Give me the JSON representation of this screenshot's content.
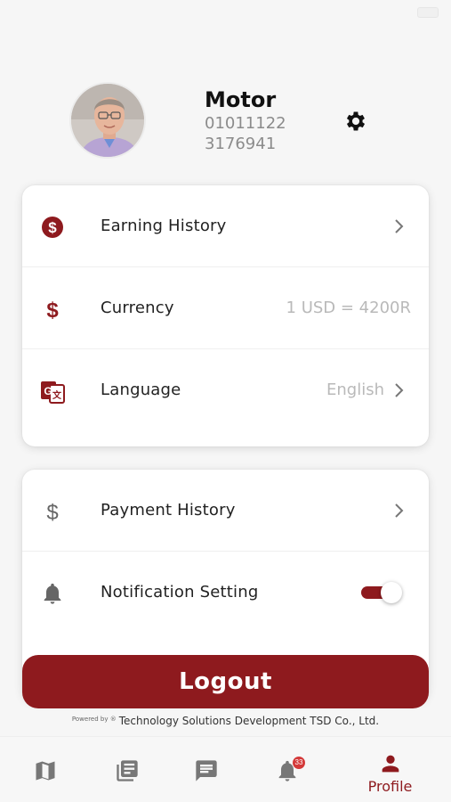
{
  "profile": {
    "name": "Motor",
    "id_line1": "01011122",
    "id_line2": "3176941"
  },
  "menu_primary": [
    {
      "label": "Earning History",
      "icon": "dollar-circle-icon"
    },
    {
      "label": "Currency",
      "value": "1 USD = 4200R",
      "icon": "dollar-icon"
    },
    {
      "label": "Language",
      "value": "English",
      "icon": "translate-icon"
    }
  ],
  "menu_secondary": [
    {
      "label": "Payment History",
      "icon": "dollar-icon"
    },
    {
      "label": "Notification Setting",
      "icon": "bell-icon",
      "toggle_on": true
    }
  ],
  "logout_label": "Logout",
  "footer": {
    "powered_by": "Powered by ®",
    "company": "Technology Solutions Development TSD Co., Ltd."
  },
  "tabs": [
    {
      "name": "map",
      "icon": "map-icon",
      "label": ""
    },
    {
      "name": "news",
      "icon": "newspaper-icon",
      "label": ""
    },
    {
      "name": "messages",
      "icon": "message-icon",
      "label": ""
    },
    {
      "name": "notifications",
      "icon": "bell-icon",
      "badge": "33",
      "label": ""
    },
    {
      "name": "profile",
      "icon": "person-icon",
      "label": "Profile",
      "active": true
    }
  ],
  "colors": {
    "brand": "#8e1a1e",
    "muted_text": "#b9b9b9",
    "tab_inactive": "#777777"
  }
}
